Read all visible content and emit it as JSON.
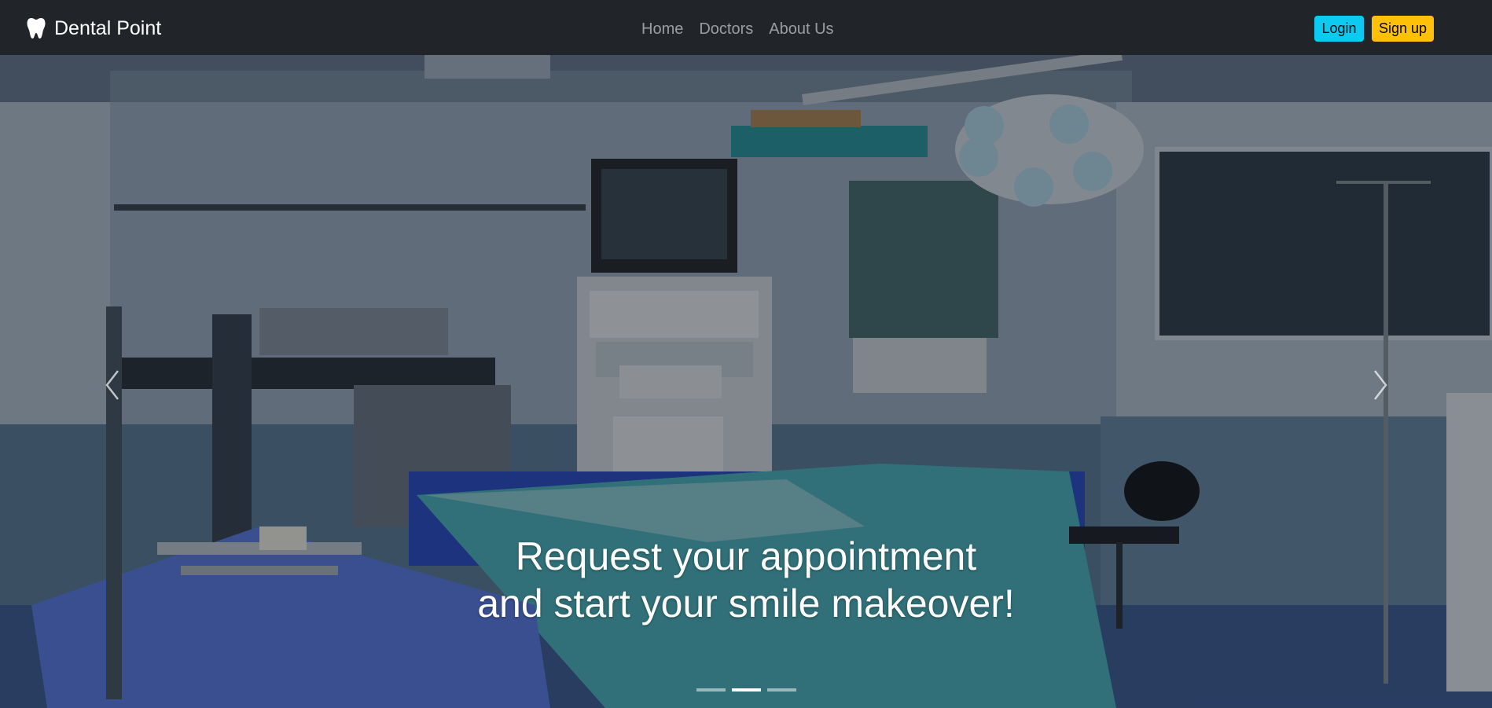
{
  "navbar": {
    "brand": "Dental Point",
    "brand_icon": "tooth-icon",
    "links": [
      {
        "label": "Home"
      },
      {
        "label": "Doctors"
      },
      {
        "label": "About Us"
      }
    ],
    "login_label": "Login",
    "signup_label": "Sign up",
    "colors": {
      "background": "#212529",
      "login": "#0dcaf0",
      "signup": "#ffc107"
    }
  },
  "carousel": {
    "caption_line1": "Request your appointment",
    "caption_line2": "and start your smile makeover!",
    "prev_icon": "chevron-left-icon",
    "next_icon": "chevron-right-icon",
    "slide_count": 3,
    "active_slide": 2
  }
}
